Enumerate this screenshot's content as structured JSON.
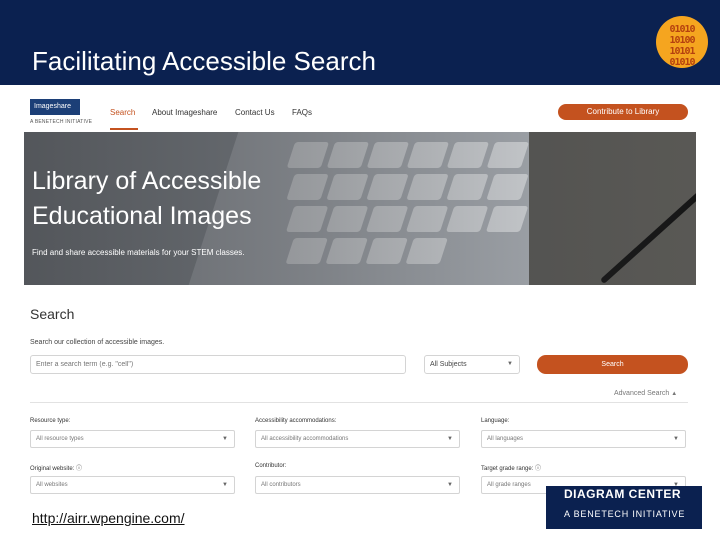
{
  "slide": {
    "title": "Facilitating Accessible Search",
    "logo_bits": "01010\n10100\n10101\n01010",
    "url": "http://airr.wpengine.com/",
    "badge": {
      "line1": "DIAGRAM CENTER",
      "line2": "A BENETECH INITIATIVE"
    }
  },
  "site": {
    "brand": "Imageshare",
    "brand_sub": "A BENETECH INITIATIVE",
    "nav": [
      "Search",
      "About Imageshare",
      "Contact Us",
      "FAQs"
    ],
    "contribute_label": "Contribute to Library",
    "hero": {
      "title_line1": "Library of Accessible",
      "title_line2": "Educational Images",
      "subtitle": "Find and share accessible materials for your STEM classes."
    },
    "search": {
      "heading": "Search",
      "hint": "Search our collection of accessible images.",
      "placeholder": "Enter a search term (e.g. \"cell\")",
      "subjects": "All Subjects",
      "button": "Search",
      "advanced": "Advanced Search"
    },
    "filters": [
      {
        "label": "Resource type:",
        "value": "All resource types"
      },
      {
        "label": "Accessibility accommodations:",
        "value": "All accessibility accommodations"
      },
      {
        "label": "Language:",
        "value": "All languages"
      },
      {
        "label": "Original website:",
        "value": "All websites"
      },
      {
        "label": "Contributor:",
        "value": "All contributors"
      },
      {
        "label": "Target grade range:",
        "value": "All grade ranges"
      }
    ]
  },
  "colors": {
    "header": "#0b2150",
    "accent": "#c4521f",
    "logo": "#f5a51f"
  }
}
